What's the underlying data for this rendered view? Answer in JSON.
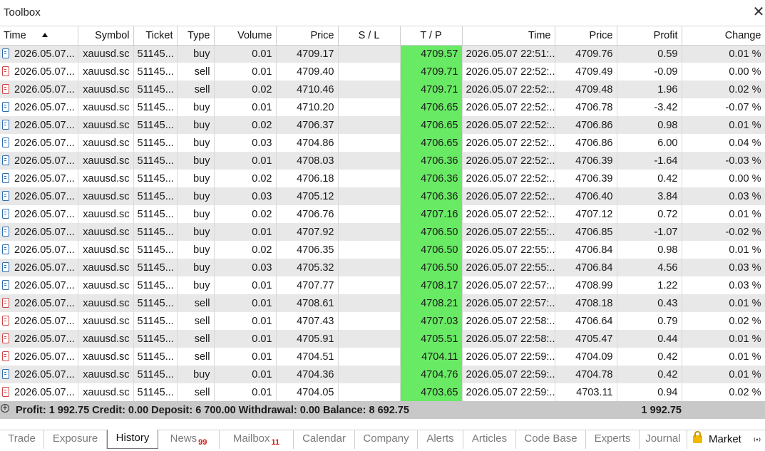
{
  "window": {
    "title": "Toolbox"
  },
  "columns": [
    "Time",
    "Symbol",
    "Ticket",
    "Type",
    "Volume",
    "Price",
    "S / L",
    "T / P",
    "Time",
    "Price",
    "Profit",
    "Change"
  ],
  "rows": [
    {
      "open_time": "2026.05.07...",
      "symbol": "xauusd.sc",
      "ticket": "51145...",
      "type": "buy",
      "volume": "0.01",
      "price": "4709.17",
      "sl": "",
      "tp": "4709.57",
      "close_time": "2026.05.07 22:51:...",
      "close_price": "4709.76",
      "profit": "0.59",
      "change": "0.01 %"
    },
    {
      "open_time": "2026.05.07...",
      "symbol": "xauusd.sc",
      "ticket": "51145...",
      "type": "sell",
      "volume": "0.01",
      "price": "4709.40",
      "sl": "",
      "tp": "4709.71",
      "close_time": "2026.05.07 22:52:...",
      "close_price": "4709.49",
      "profit": "-0.09",
      "change": "0.00 %"
    },
    {
      "open_time": "2026.05.07...",
      "symbol": "xauusd.sc",
      "ticket": "51145...",
      "type": "sell",
      "volume": "0.02",
      "price": "4710.46",
      "sl": "",
      "tp": "4709.71",
      "close_time": "2026.05.07 22:52:...",
      "close_price": "4709.48",
      "profit": "1.96",
      "change": "0.02 %"
    },
    {
      "open_time": "2026.05.07...",
      "symbol": "xauusd.sc",
      "ticket": "51145...",
      "type": "buy",
      "volume": "0.01",
      "price": "4710.20",
      "sl": "",
      "tp": "4706.65",
      "close_time": "2026.05.07 22:52:...",
      "close_price": "4706.78",
      "profit": "-3.42",
      "change": "-0.07 %"
    },
    {
      "open_time": "2026.05.07...",
      "symbol": "xauusd.sc",
      "ticket": "51145...",
      "type": "buy",
      "volume": "0.02",
      "price": "4706.37",
      "sl": "",
      "tp": "4706.65",
      "close_time": "2026.05.07 22:52:...",
      "close_price": "4706.86",
      "profit": "0.98",
      "change": "0.01 %"
    },
    {
      "open_time": "2026.05.07...",
      "symbol": "xauusd.sc",
      "ticket": "51145...",
      "type": "buy",
      "volume": "0.03",
      "price": "4704.86",
      "sl": "",
      "tp": "4706.65",
      "close_time": "2026.05.07 22:52:...",
      "close_price": "4706.86",
      "profit": "6.00",
      "change": "0.04 %"
    },
    {
      "open_time": "2026.05.07...",
      "symbol": "xauusd.sc",
      "ticket": "51145...",
      "type": "buy",
      "volume": "0.01",
      "price": "4708.03",
      "sl": "",
      "tp": "4706.36",
      "close_time": "2026.05.07 22:52:...",
      "close_price": "4706.39",
      "profit": "-1.64",
      "change": "-0.03 %"
    },
    {
      "open_time": "2026.05.07...",
      "symbol": "xauusd.sc",
      "ticket": "51145...",
      "type": "buy",
      "volume": "0.02",
      "price": "4706.18",
      "sl": "",
      "tp": "4706.36",
      "close_time": "2026.05.07 22:52:...",
      "close_price": "4706.39",
      "profit": "0.42",
      "change": "0.00 %"
    },
    {
      "open_time": "2026.05.07...",
      "symbol": "xauusd.sc",
      "ticket": "51145...",
      "type": "buy",
      "volume": "0.03",
      "price": "4705.12",
      "sl": "",
      "tp": "4706.36",
      "close_time": "2026.05.07 22:52:...",
      "close_price": "4706.40",
      "profit": "3.84",
      "change": "0.03 %"
    },
    {
      "open_time": "2026.05.07...",
      "symbol": "xauusd.sc",
      "ticket": "51145...",
      "type": "buy",
      "volume": "0.02",
      "price": "4706.76",
      "sl": "",
      "tp": "4707.16",
      "close_time": "2026.05.07 22:52:...",
      "close_price": "4707.12",
      "profit": "0.72",
      "change": "0.01 %"
    },
    {
      "open_time": "2026.05.07...",
      "symbol": "xauusd.sc",
      "ticket": "51145...",
      "type": "buy",
      "volume": "0.01",
      "price": "4707.92",
      "sl": "",
      "tp": "4706.50",
      "close_time": "2026.05.07 22:55:...",
      "close_price": "4706.85",
      "profit": "-1.07",
      "change": "-0.02 %"
    },
    {
      "open_time": "2026.05.07...",
      "symbol": "xauusd.sc",
      "ticket": "51145...",
      "type": "buy",
      "volume": "0.02",
      "price": "4706.35",
      "sl": "",
      "tp": "4706.50",
      "close_time": "2026.05.07 22:55:...",
      "close_price": "4706.84",
      "profit": "0.98",
      "change": "0.01 %"
    },
    {
      "open_time": "2026.05.07...",
      "symbol": "xauusd.sc",
      "ticket": "51145...",
      "type": "buy",
      "volume": "0.03",
      "price": "4705.32",
      "sl": "",
      "tp": "4706.50",
      "close_time": "2026.05.07 22:55:...",
      "close_price": "4706.84",
      "profit": "4.56",
      "change": "0.03 %"
    },
    {
      "open_time": "2026.05.07...",
      "symbol": "xauusd.sc",
      "ticket": "51145...",
      "type": "buy",
      "volume": "0.01",
      "price": "4707.77",
      "sl": "",
      "tp": "4708.17",
      "close_time": "2026.05.07 22:57:...",
      "close_price": "4708.99",
      "profit": "1.22",
      "change": "0.03 %"
    },
    {
      "open_time": "2026.05.07...",
      "symbol": "xauusd.sc",
      "ticket": "51145...",
      "type": "sell",
      "volume": "0.01",
      "price": "4708.61",
      "sl": "",
      "tp": "4708.21",
      "close_time": "2026.05.07 22:57:...",
      "close_price": "4708.18",
      "profit": "0.43",
      "change": "0.01 %"
    },
    {
      "open_time": "2026.05.07...",
      "symbol": "xauusd.sc",
      "ticket": "51145...",
      "type": "sell",
      "volume": "0.01",
      "price": "4707.43",
      "sl": "",
      "tp": "4707.03",
      "close_time": "2026.05.07 22:58:...",
      "close_price": "4706.64",
      "profit": "0.79",
      "change": "0.02 %"
    },
    {
      "open_time": "2026.05.07...",
      "symbol": "xauusd.sc",
      "ticket": "51145...",
      "type": "sell",
      "volume": "0.01",
      "price": "4705.91",
      "sl": "",
      "tp": "4705.51",
      "close_time": "2026.05.07 22:58:...",
      "close_price": "4705.47",
      "profit": "0.44",
      "change": "0.01 %"
    },
    {
      "open_time": "2026.05.07...",
      "symbol": "xauusd.sc",
      "ticket": "51145...",
      "type": "sell",
      "volume": "0.01",
      "price": "4704.51",
      "sl": "",
      "tp": "4704.11",
      "close_time": "2026.05.07 22:59:...",
      "close_price": "4704.09",
      "profit": "0.42",
      "change": "0.01 %"
    },
    {
      "open_time": "2026.05.07...",
      "symbol": "xauusd.sc",
      "ticket": "51145...",
      "type": "buy",
      "volume": "0.01",
      "price": "4704.36",
      "sl": "",
      "tp": "4704.76",
      "close_time": "2026.05.07 22:59:...",
      "close_price": "4704.78",
      "profit": "0.42",
      "change": "0.01 %"
    },
    {
      "open_time": "2026.05.07...",
      "symbol": "xauusd.sc",
      "ticket": "51145...",
      "type": "sell",
      "volume": "0.01",
      "price": "4704.05",
      "sl": "",
      "tp": "4703.65",
      "close_time": "2026.05.07 22:59:...",
      "close_price": "4703.11",
      "profit": "0.94",
      "change": "0.02 %"
    }
  ],
  "summary": {
    "text": "Profit: 1 992.75  Credit: 0.00  Deposit: 6 700.00  Withdrawal: 0.00  Balance: 8 692.75",
    "total_profit": "1 992.75"
  },
  "tabs": [
    {
      "label": "Trade",
      "badge": ""
    },
    {
      "label": "Exposure",
      "badge": ""
    },
    {
      "label": "History",
      "badge": "",
      "active": true
    },
    {
      "label": "News",
      "badge": "99"
    },
    {
      "label": "Mailbox",
      "badge": "11"
    },
    {
      "label": "Calendar",
      "badge": ""
    },
    {
      "label": "Company",
      "badge": ""
    },
    {
      "label": "Alerts",
      "badge": ""
    },
    {
      "label": "Articles",
      "badge": ""
    },
    {
      "label": "Code Base",
      "badge": ""
    },
    {
      "label": "Experts",
      "badge": ""
    },
    {
      "label": "Journal",
      "badge": ""
    }
  ],
  "market_tab": "Market",
  "colors": {
    "tp_highlight": "#69ea64",
    "positive": "#2a2ab8",
    "negative": "#d11a1a",
    "buy_icon": "#2b6cb0",
    "sell_icon": "#d04343"
  },
  "icons": {
    "close": "close-icon",
    "sort": "sort-ascending-icon",
    "buy": "buy-document-icon",
    "sell": "sell-document-icon",
    "expand": "expand-plus-icon",
    "lock": "lock-icon",
    "signal": "signal-icon"
  }
}
